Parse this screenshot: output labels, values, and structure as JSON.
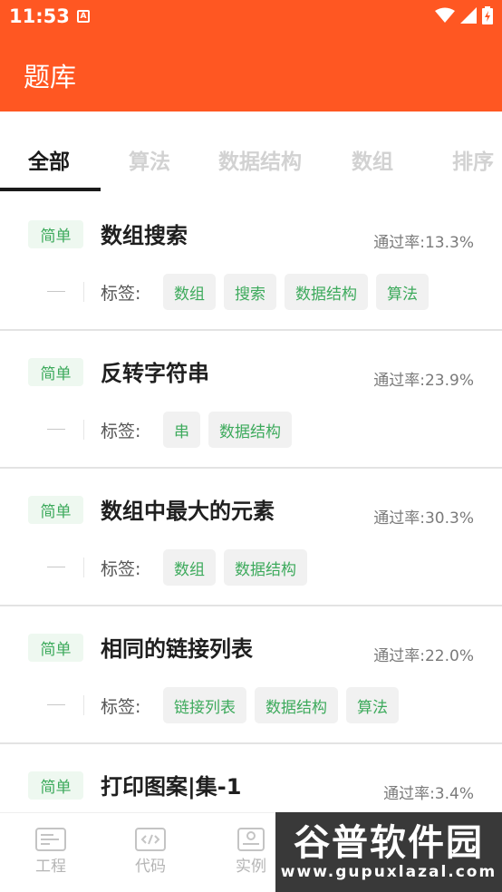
{
  "status": {
    "time": "11:53",
    "notification_glyph": "A",
    "icons": [
      "wifi-icon",
      "cell-signal-icon",
      "battery-charging-icon"
    ]
  },
  "header": {
    "title": "题库"
  },
  "tabs": [
    {
      "label": "全部",
      "active": true
    },
    {
      "label": "算法",
      "active": false
    },
    {
      "label": "数据结构",
      "active": false
    },
    {
      "label": "数组",
      "active": false
    },
    {
      "label": "排序",
      "active": false
    }
  ],
  "questions": [
    {
      "difficulty": "简单",
      "title": "数组搜索",
      "rate": "通过率:13.3%",
      "tag_label": "标签:",
      "tags": [
        "数组",
        "搜索",
        "数据结构",
        "算法"
      ]
    },
    {
      "difficulty": "简单",
      "title": "反转字符串",
      "rate": "通过率:23.9%",
      "tag_label": "标签:",
      "tags": [
        "串",
        "数据结构"
      ]
    },
    {
      "difficulty": "简单",
      "title": "数组中最大的元素",
      "rate": "通过率:30.3%",
      "tag_label": "标签:",
      "tags": [
        "数组",
        "数据结构"
      ]
    },
    {
      "difficulty": "简单",
      "title": "相同的链接列表",
      "rate": "通过率:22.0%",
      "tag_label": "标签:",
      "tags": [
        "链接列表",
        "数据结构",
        "算法"
      ]
    },
    {
      "difficulty": "简单",
      "title": "打印图案|集-1",
      "rate": "通过率:3.4%",
      "tag_label": "",
      "tags": []
    }
  ],
  "bottom_nav": [
    {
      "label": "工程",
      "icon": "project-icon"
    },
    {
      "label": "代码",
      "icon": "code-icon"
    },
    {
      "label": "实例",
      "icon": "example-icon"
    }
  ],
  "watermark": {
    "main": "谷普软件园",
    "sub": "www.gupuxlazal.com"
  },
  "colors": {
    "accent": "#ff5722",
    "tag_text": "#3daa5c",
    "tag_bg": "#f1f1f1",
    "badge_bg": "#eef8f0"
  }
}
